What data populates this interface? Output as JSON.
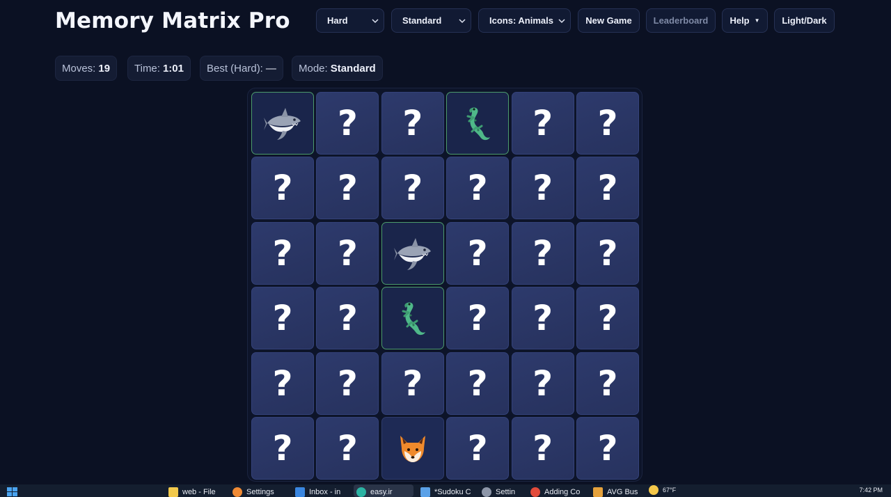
{
  "app": {
    "title": "Memory Matrix Pro"
  },
  "toolbar": {
    "difficulty": "Hard",
    "mode": "Standard",
    "icons": "Icons: Animals",
    "new_game": "New Game",
    "leaderboard": "Leaderboard",
    "help": "Help",
    "help_caret": "▼",
    "theme": "Light/Dark"
  },
  "stats": {
    "moves_label": "Moves:",
    "moves_value": "19",
    "time_label": "Time:",
    "time_value": "1:01",
    "best_label": "Best (Hard):",
    "best_value": "—",
    "mode_label": "Mode:",
    "mode_value": "Standard"
  },
  "board": {
    "rows": 6,
    "cols": 6,
    "hidden_symbol": "?",
    "cells": [
      "shark-matched",
      "hidden",
      "hidden",
      "lizard-matched",
      "hidden",
      "hidden",
      "hidden",
      "hidden",
      "hidden",
      "hidden",
      "hidden",
      "hidden",
      "hidden",
      "hidden",
      "shark-matched",
      "hidden",
      "hidden",
      "hidden",
      "hidden",
      "hidden",
      "lizard-matched",
      "hidden",
      "hidden",
      "hidden",
      "hidden",
      "hidden",
      "hidden",
      "hidden",
      "hidden",
      "hidden",
      "hidden",
      "hidden",
      "fox-revealed",
      "hidden",
      "hidden",
      "hidden"
    ]
  },
  "colors": {
    "background": "#0b1123",
    "card": "#2b3867",
    "matched_border": "#4c9b6c"
  },
  "taskbar": {
    "items": [
      "web - File",
      "Settings",
      "Inbox - in",
      "easy.ir",
      "*Sudoku C",
      "Settin",
      "Adding Co",
      "AVG Bus"
    ],
    "weather": "67°F",
    "clock": "7:42 PM"
  }
}
